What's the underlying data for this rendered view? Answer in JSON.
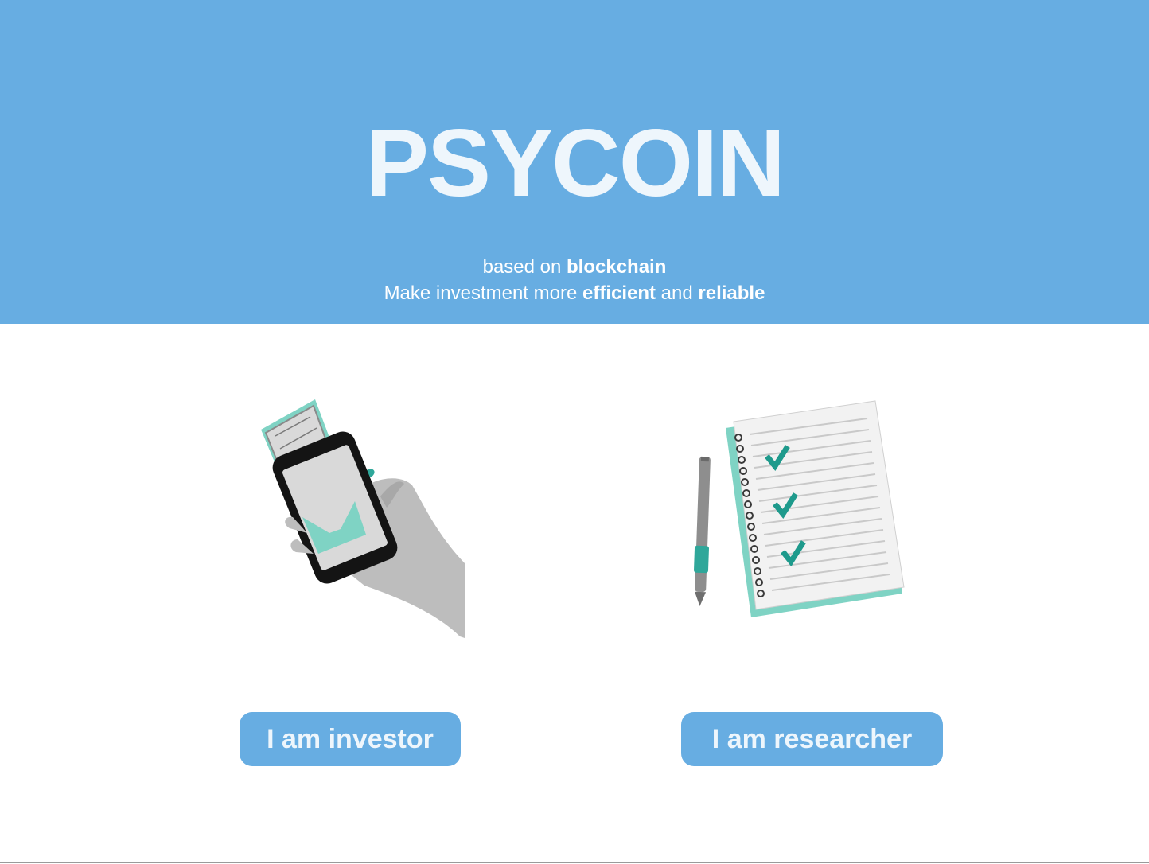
{
  "colors": {
    "brand_blue": "#67ade2",
    "accent_teal": "#7fd3c4",
    "text_light": "#eef6fc"
  },
  "hero": {
    "title": "PSYCOIN",
    "line1_prefix": "based on ",
    "line1_bold": "blockchain",
    "line2_prefix": "Make investment more ",
    "line2_bold1": "efficient",
    "line2_middle": " and ",
    "line2_bold2": "reliable"
  },
  "investor": {
    "icon": "phone-money-icon",
    "button_label": "I am investor"
  },
  "researcher": {
    "icon": "notebook-checklist-icon",
    "button_label": "I am researcher"
  }
}
